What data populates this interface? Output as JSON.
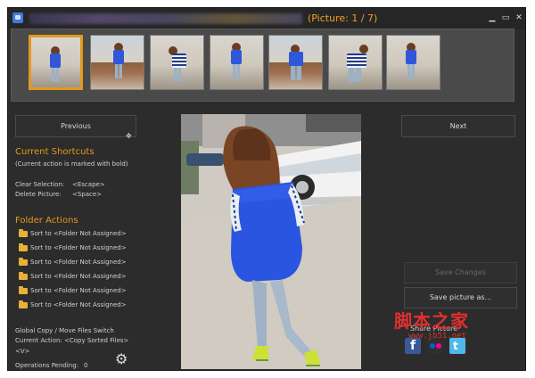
{
  "title_bar": {
    "picture_counter": "(Picture: 1 / 7)",
    "minimize": "▁",
    "maximize": "▭",
    "close": "✕"
  },
  "thumbnails": [
    {
      "label": "thumb-1",
      "selected": true
    },
    {
      "label": "thumb-2",
      "selected": false
    },
    {
      "label": "thumb-3",
      "selected": false
    },
    {
      "label": "thumb-4",
      "selected": false
    },
    {
      "label": "thumb-5",
      "selected": false
    },
    {
      "label": "thumb-6",
      "selected": false
    },
    {
      "label": "thumb-7",
      "selected": false
    }
  ],
  "left_panel": {
    "previous_label": "Previous",
    "current_shortcuts": {
      "heading": "Current Shortcuts",
      "note": "(Current action is marked with bold)",
      "clear_selection": "Clear Selection:",
      "clear_selection_key": "<Escape>",
      "delete_picture": "Delete Picture:",
      "delete_picture_key": "<Space>"
    },
    "folder_actions": {
      "heading": "Folder Actions",
      "items": [
        "Sort to <Folder Not Assigned>",
        "Sort to <Folder Not Assigned>",
        "Sort to <Folder Not Assigned>",
        "Sort to <Folder Not Assigned>",
        "Sort to <Folder Not Assigned>",
        "Sort to <Folder Not Assigned>"
      ]
    },
    "global_switch": "Global Copy / Move Files Switch",
    "current_action": "Current Action: <Copy Sorted Files>",
    "switch_key": "<V>",
    "operations_pending_label": "Operations Pending:",
    "operations_pending_value": "0"
  },
  "right_panel": {
    "next_label": "Next",
    "save_changes_label": "Save Changes",
    "save_as_label": "Save picture as...",
    "share_label": "Share Picture"
  },
  "watermark": {
    "line1": "脚本之家",
    "line2": "www.jb51.net"
  },
  "colors": {
    "accent": "#e39a1c",
    "background": "#2c2c2c",
    "button_border": "#4a4a4a"
  }
}
